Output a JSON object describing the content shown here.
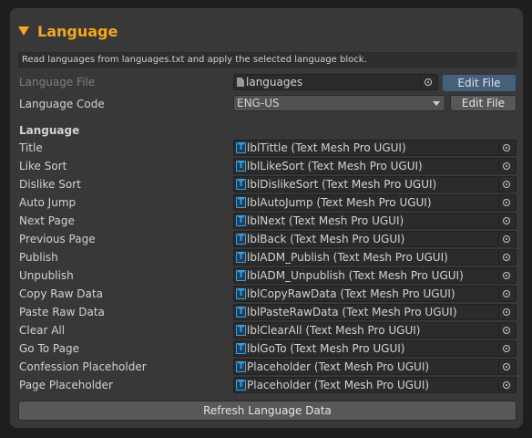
{
  "header": {
    "title": "Language"
  },
  "description": "Read languages from languages.txt and apply the selected language block.",
  "language_file": {
    "label": "Language File",
    "value": "languages",
    "edit_button": "Edit File"
  },
  "language_code": {
    "label": "Language Code",
    "value": "ENG-US",
    "edit_button": "Edit File"
  },
  "section_label": "Language",
  "fields": [
    {
      "label": "Title",
      "value": "lblTittle (Text Mesh Pro UGUI)"
    },
    {
      "label": "Like Sort",
      "value": "lblLikeSort (Text Mesh Pro UGUI)"
    },
    {
      "label": "Dislike Sort",
      "value": "lblDislikeSort (Text Mesh Pro UGUI)"
    },
    {
      "label": "Auto Jump",
      "value": "lblAutoJump (Text Mesh Pro UGUI)"
    },
    {
      "label": "Next Page",
      "value": "lblNext (Text Mesh Pro UGUI)"
    },
    {
      "label": "Previous Page",
      "value": "lblBack (Text Mesh Pro UGUI)"
    },
    {
      "label": "Publish",
      "value": "lblADM_Publish (Text Mesh Pro UGUI)"
    },
    {
      "label": "Unpublish",
      "value": "lblADM_Unpublish (Text Mesh Pro UGUI)"
    },
    {
      "label": "Copy Raw Data",
      "value": "lblCopyRawData (Text Mesh Pro UGUI)"
    },
    {
      "label": "Paste Raw Data",
      "value": "lblPasteRawData (Text Mesh Pro UGUI)"
    },
    {
      "label": "Clear All",
      "value": "lblClearAll (Text Mesh Pro UGUI)"
    },
    {
      "label": "Go To Page",
      "value": "lblGoTo (Text Mesh Pro UGUI)"
    },
    {
      "label": "Confession Placeholder",
      "value": "Placeholder (Text Mesh Pro UGUI)"
    },
    {
      "label": "Page Placeholder",
      "value": "Placeholder (Text Mesh Pro UGUI)"
    }
  ],
  "refresh_button": "Refresh Language Data",
  "icons": {
    "foldout": "triangle-down-icon",
    "file": "file-icon",
    "component": "text-mesh-pro-icon",
    "picker": "object-picker-icon"
  },
  "colors": {
    "accent": "#f3a81f",
    "panel": "#383838",
    "tmp_icon": "#3a9ee0"
  }
}
